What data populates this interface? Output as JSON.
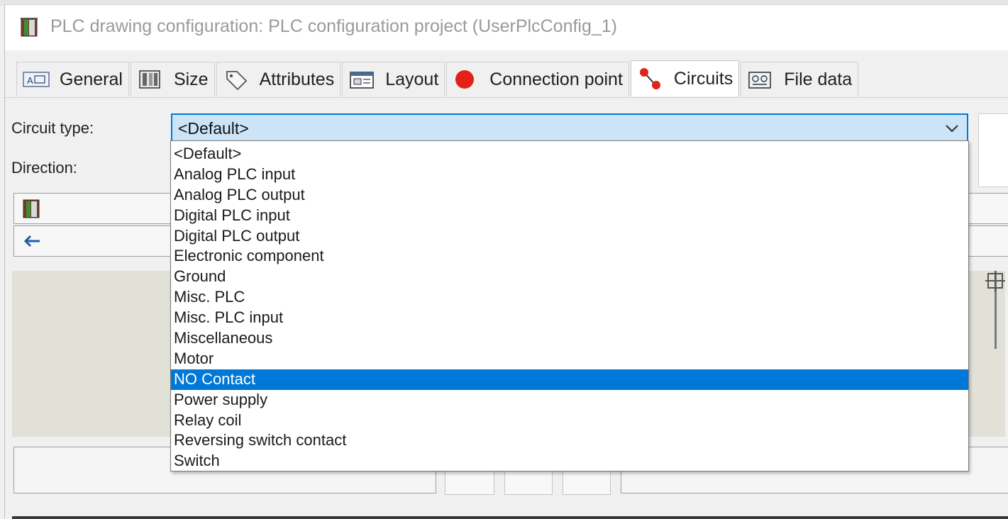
{
  "window": {
    "title": "PLC drawing configuration: PLC configuration project (UserPlcConfig_1)"
  },
  "tabs": [
    {
      "label": "General",
      "icon": "general-icon"
    },
    {
      "label": "Size",
      "icon": "size-icon"
    },
    {
      "label": "Attributes",
      "icon": "tag-icon"
    },
    {
      "label": "Layout",
      "icon": "layout-icon"
    },
    {
      "label": "Connection point",
      "icon": "red-dot-icon"
    },
    {
      "label": "Circuits",
      "icon": "circuit-icon",
      "active": true
    },
    {
      "label": "File data",
      "icon": "file-data-icon"
    }
  ],
  "form": {
    "circuit_type_label": "Circuit type:",
    "direction_label": "Direction:",
    "circuit_type_value": "<Default>"
  },
  "dropdown": {
    "selected": "NO Contact",
    "options": [
      "<Default>",
      "Analog PLC input",
      "Analog PLC output",
      "Digital PLC input",
      "Digital PLC output",
      "Electronic component",
      "Ground",
      "Misc. PLC",
      "Misc. PLC input",
      "Miscellaneous",
      "Motor",
      "NO Contact",
      "Power supply",
      "Relay coil",
      "Reversing switch contact",
      "Switch"
    ]
  },
  "colors": {
    "accent": "#0078d7",
    "combo_bg": "#cce4f7",
    "preview_bg": "#e1e1d8",
    "connection_point": "#e32119"
  },
  "icons": {
    "direction_arrow": "arrow-left-icon",
    "app": "plc-book-icon",
    "chevron": "chevron-down-icon"
  }
}
